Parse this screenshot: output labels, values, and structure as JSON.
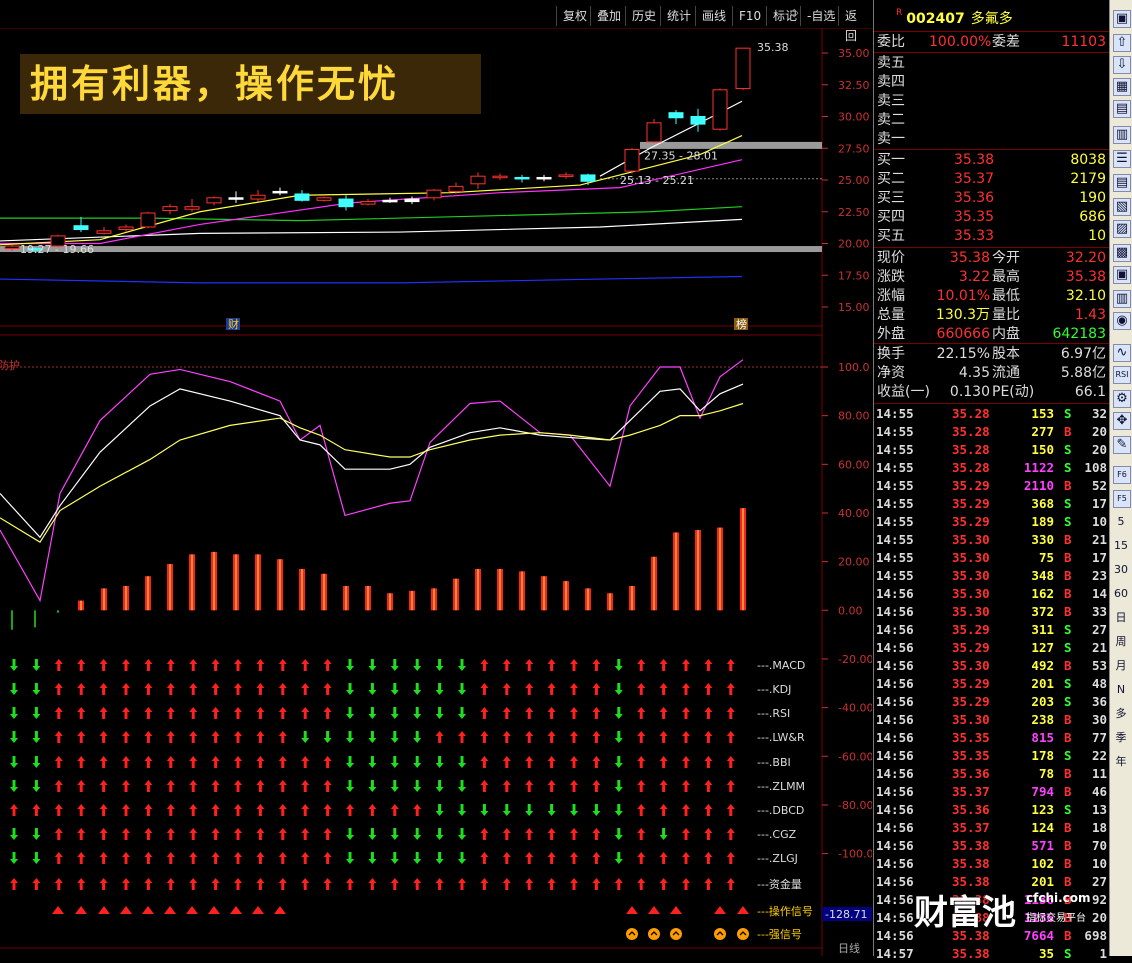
{
  "toolbar_buttons": [
    "复权",
    "叠加",
    "历史",
    "统计",
    "画线",
    "F10",
    "标记",
    "-自选",
    "返回"
  ],
  "banner": "拥有利器，操作无忧",
  "price_axis": [
    "35.00",
    "32.50",
    "30.00",
    "27.50",
    "25.00",
    "22.50",
    "20.00",
    "17.50",
    "15.00"
  ],
  "price_labels": {
    "high": "35.38",
    "low_range": "19.27 - 19.66",
    "mid_range": "25.13 - 25.21",
    "upper_range": "27.35 - 28.01"
  },
  "markers": {
    "cai": "财",
    "bang": "榜"
  },
  "indicator_label": "防护",
  "osc_axis": [
    "100.0",
    "80.00",
    "60.00",
    "40.00",
    "20.00",
    "0.00",
    "-20.00",
    "-40.00",
    "-60.00",
    "-80.00",
    "-100.0"
  ],
  "bottom_value": "-128.71",
  "bottom_right_label": "日线",
  "signal_rows": [
    {
      "name": "---.MACD",
      "s": "DDUUUUUUUUUUUUUDDDDDDUUUUUUDUUUUU"
    },
    {
      "name": "---.KDJ",
      "s": "DDUUUUUUUUUUUUUDDDDDDUUUUUUDUUUUU"
    },
    {
      "name": "---.RSI",
      "s": "DDUUUUUUUUUUUUUDDDDDDUUUUUUDUUUUU"
    },
    {
      "name": "---.LW&R",
      "s": "DDUUUUUUUUUUUDDDDDDUUUUUUUUDUUUUU"
    },
    {
      "name": "---.BBI",
      "s": "DDUUUUUUUUUUUUUDDDDDDUUUUUUDUUUUU"
    },
    {
      "name": "---.ZLMM",
      "s": "DDUUUUUUUUUUUUUDDDDDDUUUUUUDUUUUU"
    },
    {
      "name": "---.DBCD",
      "s": "UUUUUUUUUUUUUUUUUUUDDDDDDDDDUUUUU"
    },
    {
      "name": "---.CGZ",
      "s": "DDUUUUUUUUUUUUUDDDDDDUUUUUUDUDUUU"
    },
    {
      "name": "---.ZLGJ",
      "s": "DDUUUUUUUUUUUUUDDDDDDUUUUUUDUUUUU"
    },
    {
      "name": "---资金量",
      "s": "UUUUUUUUUUUUUUUUUUUUUUUUUUUUUUUUU"
    }
  ],
  "signal_op_label": "---操作信号",
  "signal_strong_label": "---强信号",
  "stock": {
    "flag": "R",
    "code": "002407",
    "name": "多氟多"
  },
  "weibi": {
    "label": "委比",
    "value": "100.00%",
    "label2": "委差",
    "value2": "11103"
  },
  "sells": [
    {
      "label": "卖五"
    },
    {
      "label": "卖四"
    },
    {
      "label": "卖三"
    },
    {
      "label": "卖二"
    },
    {
      "label": "卖一"
    }
  ],
  "buys": [
    {
      "label": "买一",
      "price": "35.38",
      "vol": "8038"
    },
    {
      "label": "买二",
      "price": "35.37",
      "vol": "2179"
    },
    {
      "label": "买三",
      "price": "35.36",
      "vol": "190"
    },
    {
      "label": "买四",
      "price": "35.35",
      "vol": "686"
    },
    {
      "label": "买五",
      "price": "35.33",
      "vol": "10"
    }
  ],
  "stats": [
    {
      "l1": "现价",
      "v1": "35.38",
      "c1": "#ff3030",
      "l2": "今开",
      "v2": "32.20",
      "c2": "#ff3030"
    },
    {
      "l1": "涨跌",
      "v1": "3.22",
      "c1": "#ff3030",
      "l2": "最高",
      "v2": "35.38",
      "c2": "#ff3030"
    },
    {
      "l1": "涨幅",
      "v1": "10.01%",
      "c1": "#ff3030",
      "l2": "最低",
      "v2": "32.10",
      "c2": "#ffff40"
    },
    {
      "l1": "总量",
      "v1": "130.3万",
      "c1": "#ffff40",
      "l2": "量比",
      "v2": "1.43",
      "c2": "#ff3030"
    },
    {
      "l1": "外盘",
      "v1": "660666",
      "c1": "#ff3030",
      "l2": "内盘",
      "v2": "642183",
      "c2": "#30ff30"
    }
  ],
  "fund": [
    {
      "l1": "换手",
      "v1": "22.15%",
      "l2": "股本",
      "v2": "6.97亿"
    },
    {
      "l1": "净资",
      "v1": "4.35",
      "l2": "流通",
      "v2": "5.88亿"
    },
    {
      "l1": "收益(一)",
      "v1": "0.130",
      "l2": "PE(动)",
      "v2": "66.1"
    }
  ],
  "ticks": [
    [
      "14:55",
      "35.28",
      "153",
      "S",
      "32"
    ],
    [
      "14:55",
      "35.28",
      "277",
      "B",
      "20"
    ],
    [
      "14:55",
      "35.28",
      "150",
      "S",
      "20"
    ],
    [
      "14:55",
      "35.28",
      "1122",
      "S",
      "108"
    ],
    [
      "14:55",
      "35.29",
      "2110",
      "B",
      "52"
    ],
    [
      "14:55",
      "35.29",
      "368",
      "S",
      "17"
    ],
    [
      "14:55",
      "35.29",
      "189",
      "S",
      "10"
    ],
    [
      "14:55",
      "35.30",
      "330",
      "B",
      "21"
    ],
    [
      "14:55",
      "35.30",
      "75",
      "B",
      "17"
    ],
    [
      "14:55",
      "35.30",
      "348",
      "B",
      "23"
    ],
    [
      "14:56",
      "35.30",
      "162",
      "B",
      "14"
    ],
    [
      "14:56",
      "35.30",
      "372",
      "B",
      "33"
    ],
    [
      "14:56",
      "35.29",
      "311",
      "S",
      "27"
    ],
    [
      "14:56",
      "35.29",
      "127",
      "S",
      "21"
    ],
    [
      "14:56",
      "35.30",
      "492",
      "B",
      "53"
    ],
    [
      "14:56",
      "35.29",
      "201",
      "S",
      "48"
    ],
    [
      "14:56",
      "35.29",
      "203",
      "S",
      "36"
    ],
    [
      "14:56",
      "35.30",
      "238",
      "B",
      "30"
    ],
    [
      "14:56",
      "35.35",
      "815",
      "B",
      "77"
    ],
    [
      "14:56",
      "35.35",
      "178",
      "S",
      "22"
    ],
    [
      "14:56",
      "35.36",
      "78",
      "B",
      "11"
    ],
    [
      "14:56",
      "35.37",
      "794",
      "B",
      "46"
    ],
    [
      "14:56",
      "35.36",
      "123",
      "S",
      "13"
    ],
    [
      "14:56",
      "35.37",
      "124",
      "B",
      "18"
    ],
    [
      "14:56",
      "35.38",
      "571",
      "B",
      "70"
    ],
    [
      "14:56",
      "35.38",
      "102",
      "B",
      "10"
    ],
    [
      "14:56",
      "35.38",
      "201",
      "B",
      "27"
    ],
    [
      "14:56",
      "35.38",
      "1136",
      "B",
      "92"
    ],
    [
      "14:56",
      "35.38",
      "1136",
      "B",
      "20"
    ],
    [
      "14:56",
      "35.38",
      "7664",
      "B",
      "698"
    ],
    [
      "14:57",
      "35.38",
      "35",
      "S",
      "1"
    ]
  ],
  "watermark": {
    "brand": "财富池",
    "site": "cfchi.com",
    "sub": "指标交易平台"
  },
  "side_tools": [
    "5",
    "15",
    "30",
    "60",
    "日",
    "周",
    "月",
    "N",
    "多",
    "季",
    "年"
  ],
  "colors": {
    "up": "#ff2020",
    "down": "#20dd20",
    "k": "#ff00ff",
    "d": "#ffffff",
    "j": "#ffff60"
  }
}
